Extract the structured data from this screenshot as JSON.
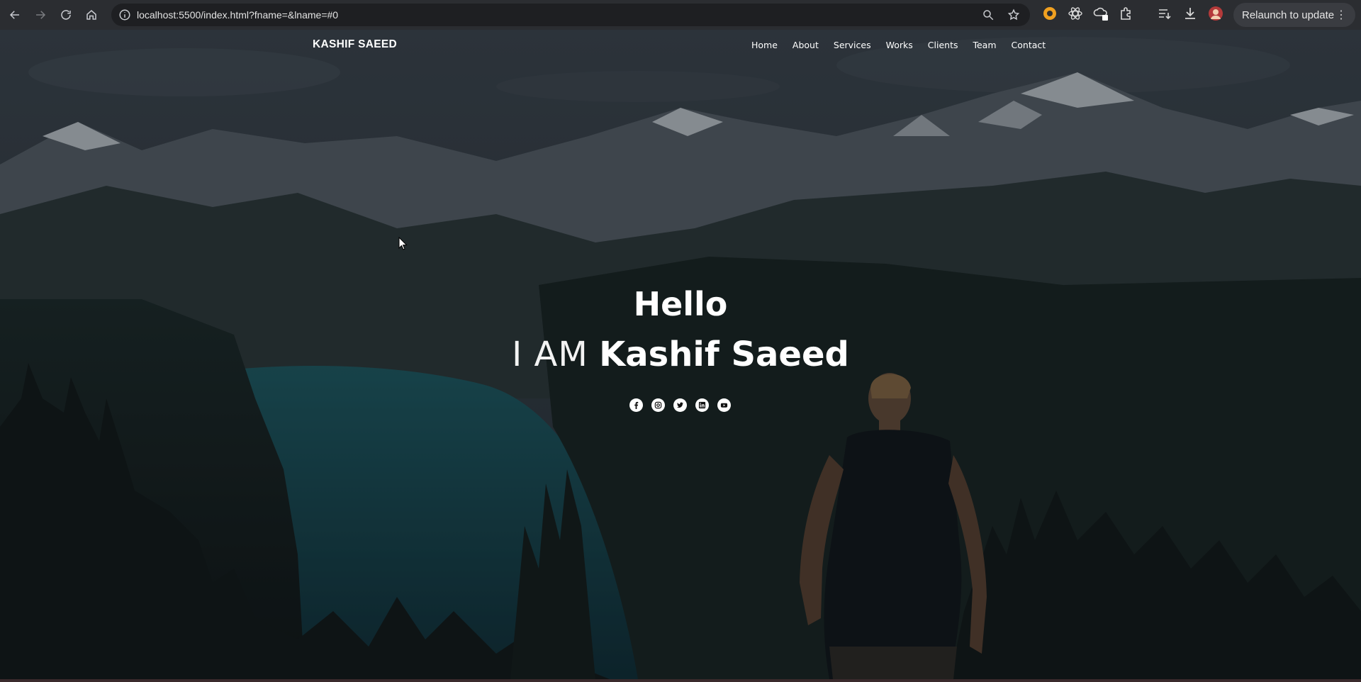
{
  "browser": {
    "url": "localhost:5500/index.html?fname=&lname=#0",
    "relaunch_label": "Relaunch to update"
  },
  "site": {
    "brand": "KASHIF SAEED",
    "menu": [
      "Home",
      "About",
      "Services",
      "Works",
      "Clients",
      "Team",
      "Contact"
    ]
  },
  "hero": {
    "greeting": "Hello",
    "intro": "I AM",
    "name": "Kashif Saeed"
  },
  "socials": [
    "facebook-icon",
    "instagram-icon",
    "twitter-icon",
    "linkedin-icon",
    "youtube-icon"
  ],
  "colors": {
    "chrome_bg": "#2b2d31",
    "omnibox_bg": "#1e1f22",
    "text": "#ffffff"
  }
}
